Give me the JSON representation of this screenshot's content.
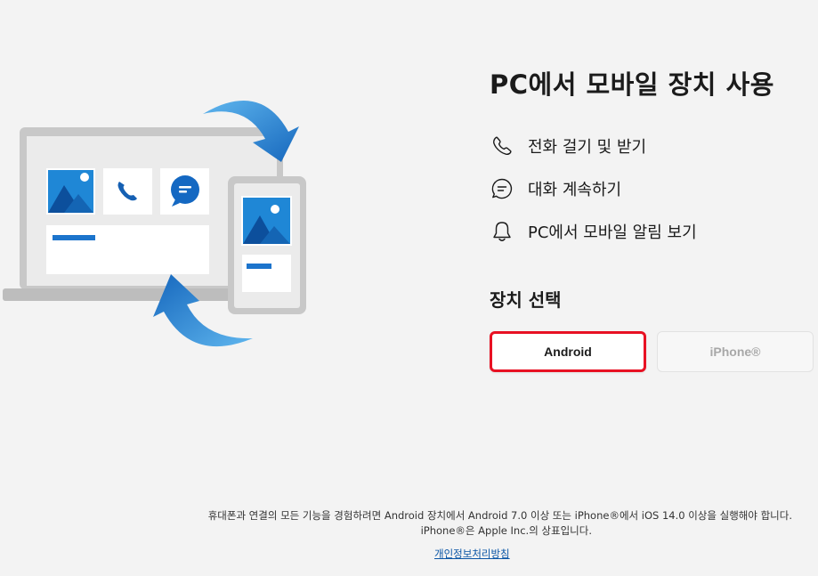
{
  "main": {
    "title": "PC에서 모바일 장치 사용",
    "features": [
      {
        "icon": "phone-icon",
        "label": "전화 걸기 및 받기"
      },
      {
        "icon": "chat-icon",
        "label": "대화 계속하기"
      },
      {
        "icon": "bell-icon",
        "label": "PC에서 모바일 알림 보기"
      }
    ],
    "device_heading": "장치 선택",
    "buttons": {
      "android": "Android",
      "iphone": "iPhone®"
    }
  },
  "footer": {
    "line1": "휴대폰과 연결의 모든 기능을 경험하려면 Android 장치에서 Android 7.0 이상 또는 iPhone®에서 iOS 14.0 이상을 실행해야 합니다.",
    "line2": "iPhone®은 Apple Inc.의 상표입니다.",
    "privacy_link": "개인정보처리방침"
  },
  "colors": {
    "background": "#f3f3f3",
    "accent": "#0067c0",
    "selected_border": "#e81123",
    "link": "#0b56a6"
  }
}
